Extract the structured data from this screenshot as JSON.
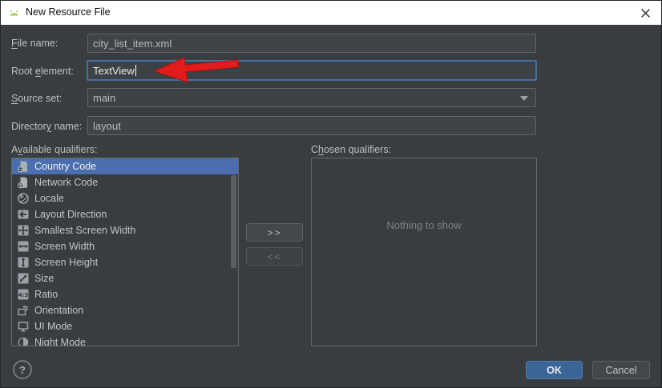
{
  "titlebar": {
    "title": "New Resource File"
  },
  "form": {
    "file_name": {
      "label_pre": "",
      "label_key": "F",
      "label_rest": "ile name:",
      "value": "city_list_item.xml"
    },
    "root_element": {
      "label_pre": "Root ",
      "label_key": "e",
      "label_rest": "lement:",
      "value": "TextView"
    },
    "source_set": {
      "label_pre": "",
      "label_key": "S",
      "label_rest": "ource set:",
      "value": "main"
    },
    "directory_name": {
      "label_pre": "Director",
      "label_key": "y",
      "label_rest": " name:",
      "value": "layout"
    }
  },
  "available": {
    "label_pre": "A",
    "label_key": "v",
    "label_rest": "ailable qualifiers:",
    "items": [
      {
        "icon": "country-code-icon",
        "label": "Country Code",
        "selected": true
      },
      {
        "icon": "network-code-icon",
        "label": "Network Code"
      },
      {
        "icon": "locale-icon",
        "label": "Locale"
      },
      {
        "icon": "layout-direction-icon",
        "label": "Layout Direction"
      },
      {
        "icon": "smallest-screen-width-icon",
        "label": "Smallest Screen Width"
      },
      {
        "icon": "screen-width-icon",
        "label": "Screen Width"
      },
      {
        "icon": "screen-height-icon",
        "label": "Screen Height"
      },
      {
        "icon": "size-icon",
        "label": "Size"
      },
      {
        "icon": "ratio-icon",
        "label": "Ratio"
      },
      {
        "icon": "orientation-icon",
        "label": "Orientation"
      },
      {
        "icon": "ui-mode-icon",
        "label": "UI Mode"
      },
      {
        "icon": "night-mode-icon",
        "label": "Night Mode"
      }
    ]
  },
  "chosen": {
    "label_pre": "C",
    "label_key": "h",
    "label_rest": "osen qualifiers:",
    "empty_text": "Nothing to show"
  },
  "transfer": {
    "add_label": ">>",
    "remove_label": "<<"
  },
  "footer": {
    "help_label": "?",
    "ok_label": "OK",
    "cancel_label": "Cancel"
  },
  "colors": {
    "selection_blue": "#4b6eaf",
    "focus_border": "#4772a0",
    "ok_button": "#3a6596",
    "annotation_arrow_red": "#e11c1c",
    "android_green": "#97c03d",
    "titlebar_bg": "#ffffff",
    "dialog_bg": "#3a3d3f"
  }
}
